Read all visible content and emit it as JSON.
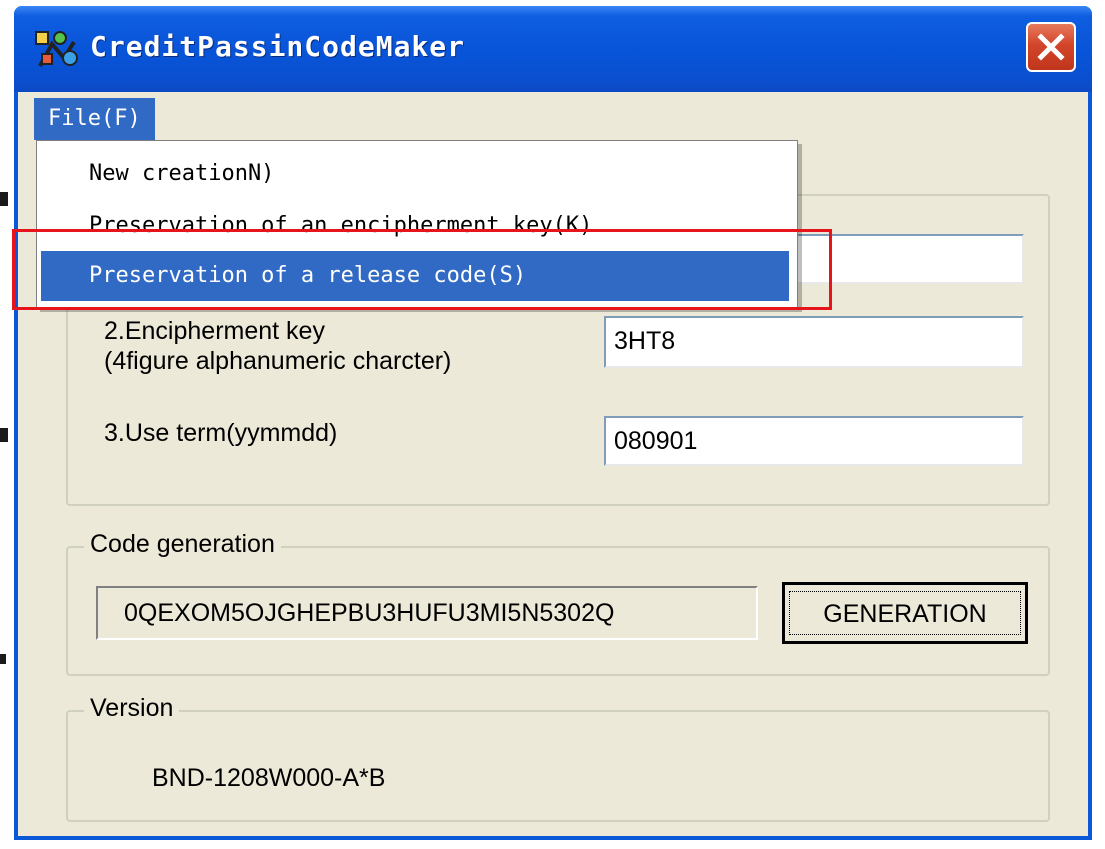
{
  "window": {
    "title": "CreditPassinCodeMaker",
    "close_symbol": "✕"
  },
  "menubar": {
    "file_label": "File(F)"
  },
  "file_menu": {
    "items": [
      {
        "label": "New creationN)",
        "highlighted": false
      },
      {
        "label": "Preservation of an encipherment key(K)",
        "highlighted": false
      },
      {
        "label": "Preservation of a release code(S)",
        "highlighted": true
      }
    ]
  },
  "form": {
    "field1_value": "",
    "field2_label_line1": "2.Encipherment key",
    "field2_label_line2": "(4figure alphanumeric charcter)",
    "field2_value": "3HT8",
    "field3_label": "3.Use term(yymmdd)",
    "field3_value": "080901"
  },
  "code_generation": {
    "legend": "Code generation",
    "code_value": "0QEXOM5OJGHEPBU3HUFU3MI5N5302Q",
    "button_label": "GENERATION"
  },
  "version": {
    "legend": "Version",
    "value": "BND-1208W000-A*B"
  },
  "colors": {
    "titlebar": "#0a58d8",
    "menu_highlight": "#316ac5",
    "annotation_red": "#e8141c",
    "client_bg": "#ece9d8"
  },
  "icons": {
    "app": "app-icon",
    "close": "close-icon"
  }
}
